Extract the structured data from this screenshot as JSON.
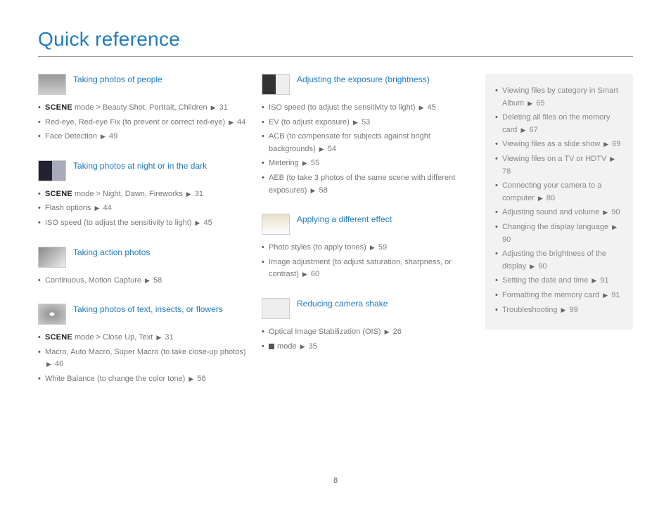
{
  "title": "Quick reference",
  "page_number": "8",
  "scene_label": "SCENE",
  "col1": [
    {
      "h": "Taking photos of people",
      "thumb": "t-people",
      "items": [
        {
          "pre": "scene",
          "t": " mode > Beauty Shot, Portrait, Children ",
          "p": "31"
        },
        {
          "t": "Red-eye, Red-eye Fix (to prevent or correct red-eye) ",
          "p": "44"
        },
        {
          "t": "Face Detection ",
          "p": "49"
        }
      ]
    },
    {
      "h": "Taking photos at night or in the dark",
      "thumb": "t-night",
      "items": [
        {
          "pre": "scene",
          "t": " mode > Night, Dawn, Fireworks ",
          "p": "31"
        },
        {
          "t": "Flash options ",
          "p": "44"
        },
        {
          "t": "ISO speed (to adjust the sensitivity to light) ",
          "p": "45"
        }
      ]
    },
    {
      "h": "Taking action photos",
      "thumb": "t-action",
      "items": [
        {
          "t": "Continuous, Motion Capture ",
          "p": "58"
        }
      ]
    },
    {
      "h": "Taking photos of text, insects, or flowers",
      "thumb": "t-flower",
      "items": [
        {
          "pre": "scene",
          "t": " mode > Close Up, Text ",
          "p": "31"
        },
        {
          "t": "Macro, Auto Macro, Super Macro (to take close-up photos) ",
          "p": "46"
        },
        {
          "t": "White Balance (to change the color tone) ",
          "p": "56"
        }
      ]
    }
  ],
  "col2": [
    {
      "h": "Adjusting the exposure (brightness)",
      "thumb": "t-expo",
      "items": [
        {
          "t": "ISO speed (to adjust the sensitivity to light) ",
          "p": "45"
        },
        {
          "t": "EV (to adjust exposure) ",
          "p": "53"
        },
        {
          "t": "ACB (to compensate for subjects against bright backgrounds) ",
          "p": "54"
        },
        {
          "t": "Metering ",
          "p": "55"
        },
        {
          "t": "AEB (to take 3 photos of the same scene with different exposures) ",
          "p": "58"
        }
      ]
    },
    {
      "h": "Applying a different effect",
      "thumb": "t-effect",
      "items": [
        {
          "t": "Photo styles (to apply tones) ",
          "p": "59"
        },
        {
          "t": "Image adjustment (to adjust saturation, sharpness, or contrast) ",
          "p": "60"
        }
      ]
    },
    {
      "h": "Reducing camera shake",
      "thumb": "t-shake",
      "items": [
        {
          "t": "Optical Image Stabilization (OIS) ",
          "p": "26"
        },
        {
          "pre": "dual",
          "t": " mode ",
          "p": "35"
        }
      ]
    }
  ],
  "sidebar": [
    {
      "t": "Viewing files by category in Smart Album ",
      "p": "65"
    },
    {
      "t": "Deleting all files on the memory card ",
      "p": "67"
    },
    {
      "t": "Viewing files as a slide show ",
      "p": "69"
    },
    {
      "t": "Viewing files on a TV or HDTV ",
      "p": "78"
    },
    {
      "t": "Connecting your camera to a computer ",
      "p": "80"
    },
    {
      "t": "Adjusting sound and volume ",
      "p": "90"
    },
    {
      "t": "Changing the display language ",
      "p": "90"
    },
    {
      "t": "Adjusting the brightness of the display ",
      "p": "90"
    },
    {
      "t": "Setting the date and time ",
      "p": "91"
    },
    {
      "t": "Formatting the memory card ",
      "p": "91"
    },
    {
      "t": "Troubleshooting ",
      "p": "99"
    }
  ]
}
